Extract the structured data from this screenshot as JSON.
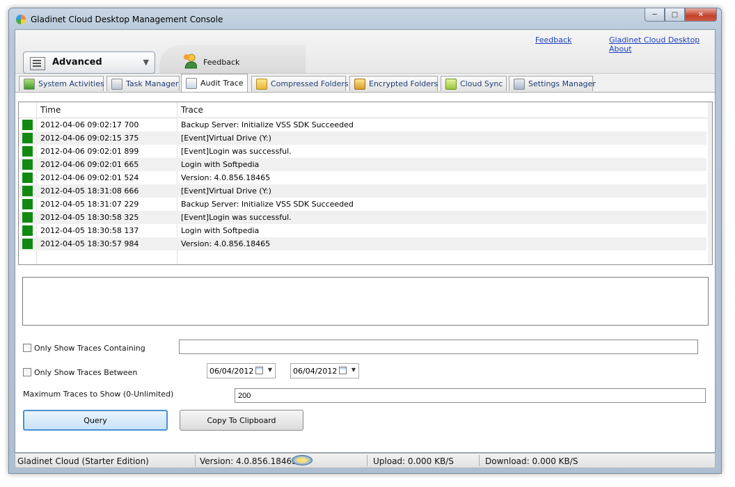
{
  "window": {
    "title": "Gladinet Cloud Desktop Management Console",
    "controls": [
      "minimize",
      "maximize",
      "close"
    ]
  },
  "header": {
    "links": {
      "feedback": "Feedback",
      "about": "Gladinet Cloud Desktop About"
    },
    "mode_combo": {
      "selected": "Advanced"
    },
    "ribbon_tab": {
      "label": "Feedback"
    }
  },
  "tabs": [
    {
      "label": "System Activities",
      "icon": "system-activities-icon",
      "active": false
    },
    {
      "label": "Task Manager",
      "icon": "task-manager-icon",
      "active": false
    },
    {
      "label": "Audit Trace",
      "icon": "audit-trace-icon",
      "active": true
    },
    {
      "label": "Compressed Folders",
      "icon": "compressed-folder-icon",
      "active": false
    },
    {
      "label": "Encrypted Folders",
      "icon": "encrypted-folder-icon",
      "active": false
    },
    {
      "label": "Cloud Sync",
      "icon": "cloud-sync-icon",
      "active": false
    },
    {
      "label": "Settings Manager",
      "icon": "settings-manager-icon",
      "active": false
    }
  ],
  "trace_grid": {
    "columns": {
      "time": "Time",
      "trace": "Trace"
    },
    "status_color": "#118a11",
    "rows": [
      {
        "time": "2012-04-06 09:02:17 700",
        "trace": "Backup Server: Initialize VSS SDK Succeeded"
      },
      {
        "time": "2012-04-06 09:02:15 375",
        "trace": "[Event]Virtual Drive (Y:)"
      },
      {
        "time": "2012-04-06 09:02:01 899",
        "trace": "[Event]Login was successful."
      },
      {
        "time": "2012-04-06 09:02:01 665",
        "trace": "Login with Softpedia"
      },
      {
        "time": "2012-04-06 09:02:01 524",
        "trace": "Version: 4.0.856.18465"
      },
      {
        "time": "2012-04-05 18:31:08 666",
        "trace": "[Event]Virtual Drive (Y:)"
      },
      {
        "time": "2012-04-05 18:31:07 229",
        "trace": "Backup Server: Initialize VSS SDK Succeeded"
      },
      {
        "time": "2012-04-05 18:30:58 325",
        "trace": "[Event]Login was successful."
      },
      {
        "time": "2012-04-05 18:30:58 137",
        "trace": "Login with Softpedia"
      },
      {
        "time": "2012-04-05 18:30:57 984",
        "trace": "Version: 4.0.856.18465"
      }
    ]
  },
  "filters": {
    "contains": {
      "label": "Only Show Traces Containing",
      "checked": false,
      "value": ""
    },
    "between": {
      "label": "Only Show Traces Between",
      "checked": false,
      "from": "06/04/2012",
      "to": "06/04/2012"
    },
    "max_traces": {
      "label": "Maximum Traces to Show (0-Unlimited)",
      "value": "200"
    }
  },
  "buttons": {
    "query": "Query",
    "copy": "Copy To Clipboard"
  },
  "statusbar": {
    "edition": "Gladinet Cloud (Starter Edition)",
    "version": "Version: 4.0.856.18465",
    "upload": "Upload: 0.000 KB/S",
    "download": "Download: 0.000 KB/S"
  }
}
